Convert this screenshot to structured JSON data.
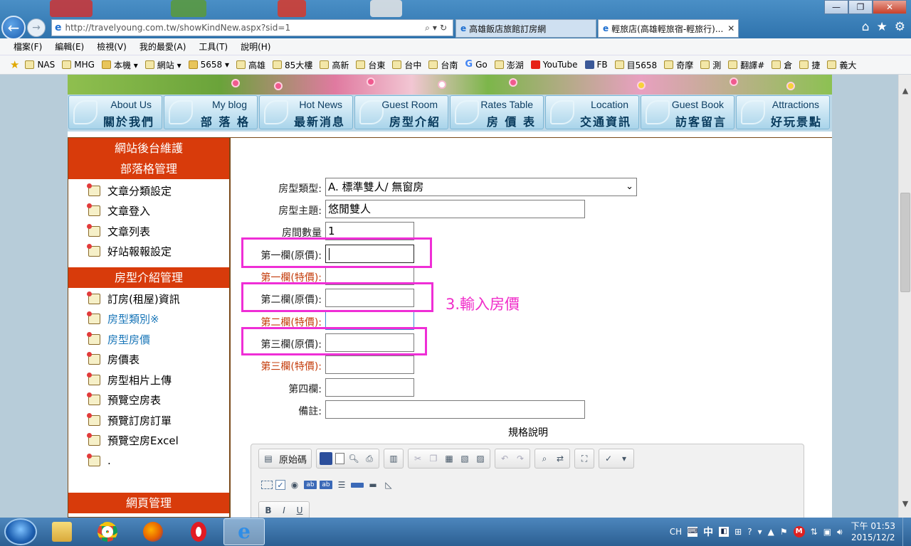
{
  "window": {
    "url": "http://travelyoung.com.tw/showKindNew.aspx?sid=1",
    "tabs": [
      {
        "label": "高雄飯店旅館訂房網",
        "active": false
      },
      {
        "label": "輕旅店(高雄輕旅宿-輕旅行)...",
        "active": true
      }
    ],
    "controls": {
      "minimize": "—",
      "maximize": "❐",
      "close": "✕"
    }
  },
  "menu": [
    "檔案(F)",
    "編輯(E)",
    "檢視(V)",
    "我的最愛(A)",
    "工具(T)",
    "說明(H)"
  ],
  "favorites": [
    {
      "label": "NAS",
      "icon": "page"
    },
    {
      "label": "MHG",
      "icon": "page"
    },
    {
      "label": "本機 ▾",
      "icon": "folder"
    },
    {
      "label": "網站 ▾",
      "icon": "page"
    },
    {
      "label": "5658 ▾",
      "icon": "folder"
    },
    {
      "label": "高雄",
      "icon": "page"
    },
    {
      "label": "85大樓",
      "icon": "page"
    },
    {
      "label": "高新",
      "icon": "page"
    },
    {
      "label": "台東",
      "icon": "page"
    },
    {
      "label": "台中",
      "icon": "page"
    },
    {
      "label": "台南",
      "icon": "page"
    },
    {
      "label": "Go",
      "icon": "g"
    },
    {
      "label": "澎湖",
      "icon": "page"
    },
    {
      "label": "YouTube",
      "icon": "yt"
    },
    {
      "label": "FB",
      "icon": "fb"
    },
    {
      "label": "目5658",
      "icon": "page"
    },
    {
      "label": "奇摩",
      "icon": "page"
    },
    {
      "label": "測",
      "icon": "page"
    },
    {
      "label": "翻譯#",
      "icon": "page"
    },
    {
      "label": "倉",
      "icon": "page"
    },
    {
      "label": "捷",
      "icon": "page"
    },
    {
      "label": "義大",
      "icon": "page"
    }
  ],
  "topnav": [
    {
      "en": "About Us",
      "zh": "關於我們"
    },
    {
      "en": "My blog",
      "zh": "部 落 格"
    },
    {
      "en": "Hot News",
      "zh": "最新消息"
    },
    {
      "en": "Guest Room",
      "zh": "房型介紹"
    },
    {
      "en": "Rates Table",
      "zh": "房 價 表"
    },
    {
      "en": "Location",
      "zh": "交通資訊"
    },
    {
      "en": "Guest Book",
      "zh": "訪客留言"
    },
    {
      "en": "Attractions",
      "zh": "好玩景點"
    }
  ],
  "sidebar": {
    "title": "網站後台維護",
    "blog_header": "部落格管理",
    "blog_items": [
      "文章分類設定",
      "文章登入",
      "文章列表",
      "好站報報設定"
    ],
    "room_header": "房型介紹管理",
    "room_items": [
      {
        "label": "訂房(租屋)資訊",
        "link": false
      },
      {
        "label": "房型類別※",
        "link": true
      },
      {
        "label": "房型房價",
        "link": true
      },
      {
        "label": "房價表",
        "link": false
      },
      {
        "label": "房型相片上傳",
        "link": false
      },
      {
        "label": "預覽空房表",
        "link": false
      },
      {
        "label": "預覽訂房訂單",
        "link": false
      },
      {
        "label": "預覽空房Excel",
        "link": false
      },
      {
        "label": ".",
        "link": false
      }
    ],
    "web_header": "網頁管理"
  },
  "form": {
    "room_type_label": "房型類型:",
    "room_type_value": "A. 標準雙人/ 無窗房",
    "room_subject_label": "房型主題:",
    "room_subject_value": "悠閒雙人",
    "room_count_label": "房間數量",
    "room_count_value": "1",
    "col1_orig_label": "第一欄(原價):",
    "col1_special_label": "第一欄(特價):",
    "col2_orig_label": "第二欄(原價):",
    "col2_special_label": "第二欄(特價):",
    "col3_orig_label": "第三欄(原價):",
    "col3_special_label": "第三欄(特價):",
    "col4_label": "第四欄:",
    "notes_label": "備註:",
    "spec_label": "規格說明",
    "annotation": "3.輸入房價"
  },
  "editor": {
    "source_label": "原始碼"
  },
  "colors": {
    "highlight": "#ef2ed6",
    "sidebar_header": "#d83b0b",
    "special_label": "#c43c0b",
    "link": "#1976b8"
  },
  "taskbar": {
    "apps": [
      "folder",
      "chrome",
      "firefox",
      "opera",
      "ie"
    ],
    "tray": {
      "lang": "CH",
      "ime": "中",
      "time": "下午 01:53",
      "date": "2015/12/2"
    }
  }
}
